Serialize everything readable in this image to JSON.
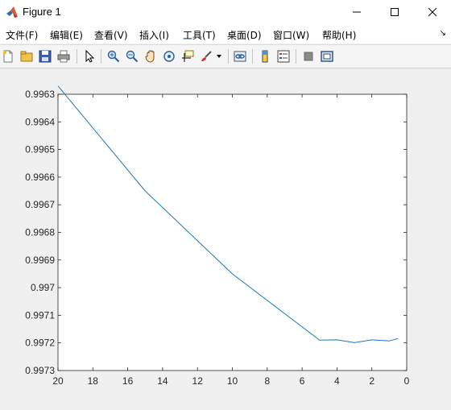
{
  "window": {
    "title": "Figure 1"
  },
  "menu": {
    "items": [
      {
        "label": "文件(F)"
      },
      {
        "label": "编辑(E)"
      },
      {
        "label": "查看(V)"
      },
      {
        "label": "插入(I)"
      },
      {
        "label": "工具(T)"
      },
      {
        "label": "桌面(D)"
      },
      {
        "label": "窗口(W)"
      },
      {
        "label": "帮助(H)"
      }
    ],
    "more_glyph": "↘"
  },
  "toolbar": {
    "icons": [
      "new-figure-icon",
      "open-file-icon",
      "save-icon",
      "print-icon",
      "pointer-icon",
      "zoom-in-icon",
      "zoom-out-icon",
      "pan-icon",
      "rotate-3d-icon",
      "data-cursor-icon",
      "brush-icon",
      "link-plot-icon",
      "colorbar-icon",
      "legend-icon",
      "hide-plot-tools-icon",
      "show-plot-tools-icon"
    ]
  },
  "colors": {
    "line": "#1f77b4",
    "axes_bg": "#ffffff",
    "figure_bg": "#f0f0f0"
  },
  "chart_data": {
    "type": "line",
    "x": [
      20,
      15,
      10,
      5,
      4,
      3,
      2,
      1,
      0.5
    ],
    "y": [
      0.99627,
      0.99665,
      0.99695,
      0.99719,
      0.997189,
      0.997199,
      0.997189,
      0.997193,
      0.997184
    ],
    "xlim": [
      20,
      0
    ],
    "ylim": [
      0.9963,
      0.9973
    ],
    "x_reversed": true,
    "y_reversed": true,
    "x_ticks": [
      20,
      18,
      16,
      14,
      12,
      10,
      8,
      6,
      4,
      2,
      0
    ],
    "x_tick_labels": [
      "20",
      "18",
      "16",
      "14",
      "12",
      "10",
      "8",
      "6",
      "4",
      "2",
      "0"
    ],
    "y_ticks": [
      0.9963,
      0.9964,
      0.9965,
      0.9966,
      0.9967,
      0.9968,
      0.9969,
      0.997,
      0.9971,
      0.9972,
      0.9973
    ],
    "y_tick_labels": [
      "0.9963",
      "0.9964",
      "0.9965",
      "0.9966",
      "0.9967",
      "0.9968",
      "0.9969",
      "0.997",
      "0.9971",
      "0.9972",
      "0.9973"
    ],
    "grid": false
  }
}
